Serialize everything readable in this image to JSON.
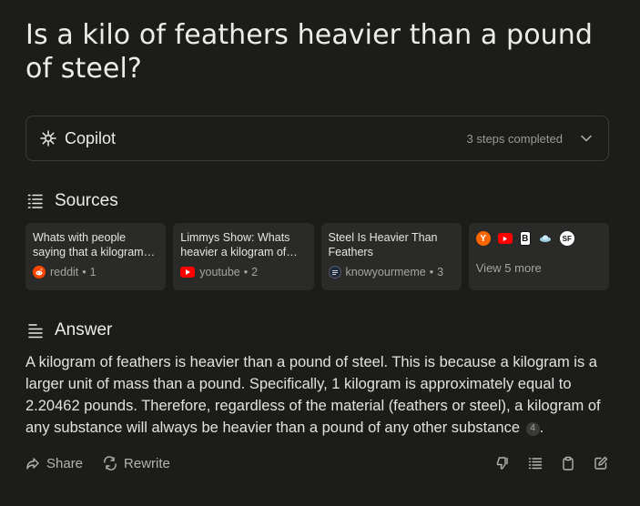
{
  "question": "Is a kilo of feathers heavier than a pound of steel?",
  "copilot": {
    "title": "Copilot",
    "status": "3 steps completed"
  },
  "sources": {
    "heading": "Sources",
    "cards": [
      {
        "title": "Whats with people saying that a kilogram…",
        "site": "reddit",
        "index": "1",
        "icon": "reddit-icon"
      },
      {
        "title": "Limmys Show: Whats heavier a kilogram of…",
        "site": "youtube",
        "index": "2",
        "icon": "youtube-icon"
      },
      {
        "title": "Steel Is Heavier Than Feathers",
        "site": "knowyourmeme",
        "index": "3",
        "icon": "knowyourmeme-icon"
      }
    ],
    "more": {
      "label": "View 5 more",
      "icons": [
        "ycombinator-icon",
        "youtube-icon",
        "b-logo-icon",
        "cloud-icon",
        "sf-logo-icon"
      ],
      "icon_letters": {
        "ycombinator": "Y",
        "b_logo": "B",
        "sf_logo": "SF"
      }
    },
    "dot": "•"
  },
  "answer": {
    "heading": "Answer",
    "text": "A kilogram of feathers is heavier than a pound of steel. This is because a kilogram is a larger unit of mass than a pound. Specifically, 1 kilogram is approximately equal to 2.20462 pounds. Therefore, regardless of the material (feathers or steel), a kilogram of any substance will always be heavier than a pound of any other substance",
    "citation": "4",
    "end": "."
  },
  "actions": {
    "share": "Share",
    "rewrite": "Rewrite"
  },
  "colors": {
    "background": "#1c1c1b",
    "card": "#2a2a28",
    "reddit": "#ff4500",
    "youtube": "#ff0000",
    "ycombinator": "#ff6600"
  }
}
